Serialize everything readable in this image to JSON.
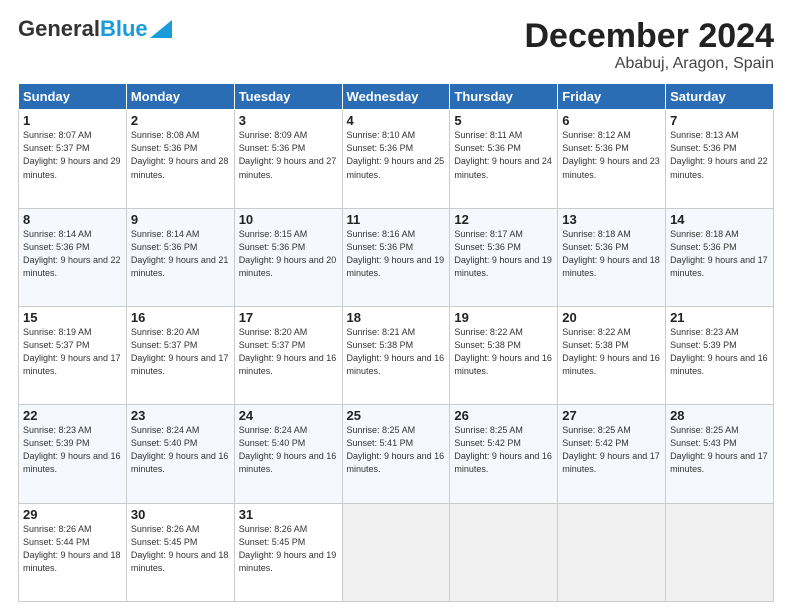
{
  "header": {
    "logo_general": "General",
    "logo_blue": "Blue",
    "month": "December 2024",
    "location": "Ababuj, Aragon, Spain"
  },
  "days_of_week": [
    "Sunday",
    "Monday",
    "Tuesday",
    "Wednesday",
    "Thursday",
    "Friday",
    "Saturday"
  ],
  "weeks": [
    [
      {
        "day": "1",
        "sunrise": "Sunrise: 8:07 AM",
        "sunset": "Sunset: 5:37 PM",
        "daylight": "Daylight: 9 hours and 29 minutes."
      },
      {
        "day": "2",
        "sunrise": "Sunrise: 8:08 AM",
        "sunset": "Sunset: 5:36 PM",
        "daylight": "Daylight: 9 hours and 28 minutes."
      },
      {
        "day": "3",
        "sunrise": "Sunrise: 8:09 AM",
        "sunset": "Sunset: 5:36 PM",
        "daylight": "Daylight: 9 hours and 27 minutes."
      },
      {
        "day": "4",
        "sunrise": "Sunrise: 8:10 AM",
        "sunset": "Sunset: 5:36 PM",
        "daylight": "Daylight: 9 hours and 25 minutes."
      },
      {
        "day": "5",
        "sunrise": "Sunrise: 8:11 AM",
        "sunset": "Sunset: 5:36 PM",
        "daylight": "Daylight: 9 hours and 24 minutes."
      },
      {
        "day": "6",
        "sunrise": "Sunrise: 8:12 AM",
        "sunset": "Sunset: 5:36 PM",
        "daylight": "Daylight: 9 hours and 23 minutes."
      },
      {
        "day": "7",
        "sunrise": "Sunrise: 8:13 AM",
        "sunset": "Sunset: 5:36 PM",
        "daylight": "Daylight: 9 hours and 22 minutes."
      }
    ],
    [
      {
        "day": "8",
        "sunrise": "Sunrise: 8:14 AM",
        "sunset": "Sunset: 5:36 PM",
        "daylight": "Daylight: 9 hours and 22 minutes."
      },
      {
        "day": "9",
        "sunrise": "Sunrise: 8:14 AM",
        "sunset": "Sunset: 5:36 PM",
        "daylight": "Daylight: 9 hours and 21 minutes."
      },
      {
        "day": "10",
        "sunrise": "Sunrise: 8:15 AM",
        "sunset": "Sunset: 5:36 PM",
        "daylight": "Daylight: 9 hours and 20 minutes."
      },
      {
        "day": "11",
        "sunrise": "Sunrise: 8:16 AM",
        "sunset": "Sunset: 5:36 PM",
        "daylight": "Daylight: 9 hours and 19 minutes."
      },
      {
        "day": "12",
        "sunrise": "Sunrise: 8:17 AM",
        "sunset": "Sunset: 5:36 PM",
        "daylight": "Daylight: 9 hours and 19 minutes."
      },
      {
        "day": "13",
        "sunrise": "Sunrise: 8:18 AM",
        "sunset": "Sunset: 5:36 PM",
        "daylight": "Daylight: 9 hours and 18 minutes."
      },
      {
        "day": "14",
        "sunrise": "Sunrise: 8:18 AM",
        "sunset": "Sunset: 5:36 PM",
        "daylight": "Daylight: 9 hours and 17 minutes."
      }
    ],
    [
      {
        "day": "15",
        "sunrise": "Sunrise: 8:19 AM",
        "sunset": "Sunset: 5:37 PM",
        "daylight": "Daylight: 9 hours and 17 minutes."
      },
      {
        "day": "16",
        "sunrise": "Sunrise: 8:20 AM",
        "sunset": "Sunset: 5:37 PM",
        "daylight": "Daylight: 9 hours and 17 minutes."
      },
      {
        "day": "17",
        "sunrise": "Sunrise: 8:20 AM",
        "sunset": "Sunset: 5:37 PM",
        "daylight": "Daylight: 9 hours and 16 minutes."
      },
      {
        "day": "18",
        "sunrise": "Sunrise: 8:21 AM",
        "sunset": "Sunset: 5:38 PM",
        "daylight": "Daylight: 9 hours and 16 minutes."
      },
      {
        "day": "19",
        "sunrise": "Sunrise: 8:22 AM",
        "sunset": "Sunset: 5:38 PM",
        "daylight": "Daylight: 9 hours and 16 minutes."
      },
      {
        "day": "20",
        "sunrise": "Sunrise: 8:22 AM",
        "sunset": "Sunset: 5:38 PM",
        "daylight": "Daylight: 9 hours and 16 minutes."
      },
      {
        "day": "21",
        "sunrise": "Sunrise: 8:23 AM",
        "sunset": "Sunset: 5:39 PM",
        "daylight": "Daylight: 9 hours and 16 minutes."
      }
    ],
    [
      {
        "day": "22",
        "sunrise": "Sunrise: 8:23 AM",
        "sunset": "Sunset: 5:39 PM",
        "daylight": "Daylight: 9 hours and 16 minutes."
      },
      {
        "day": "23",
        "sunrise": "Sunrise: 8:24 AM",
        "sunset": "Sunset: 5:40 PM",
        "daylight": "Daylight: 9 hours and 16 minutes."
      },
      {
        "day": "24",
        "sunrise": "Sunrise: 8:24 AM",
        "sunset": "Sunset: 5:40 PM",
        "daylight": "Daylight: 9 hours and 16 minutes."
      },
      {
        "day": "25",
        "sunrise": "Sunrise: 8:25 AM",
        "sunset": "Sunset: 5:41 PM",
        "daylight": "Daylight: 9 hours and 16 minutes."
      },
      {
        "day": "26",
        "sunrise": "Sunrise: 8:25 AM",
        "sunset": "Sunset: 5:42 PM",
        "daylight": "Daylight: 9 hours and 16 minutes."
      },
      {
        "day": "27",
        "sunrise": "Sunrise: 8:25 AM",
        "sunset": "Sunset: 5:42 PM",
        "daylight": "Daylight: 9 hours and 17 minutes."
      },
      {
        "day": "28",
        "sunrise": "Sunrise: 8:25 AM",
        "sunset": "Sunset: 5:43 PM",
        "daylight": "Daylight: 9 hours and 17 minutes."
      }
    ],
    [
      {
        "day": "29",
        "sunrise": "Sunrise: 8:26 AM",
        "sunset": "Sunset: 5:44 PM",
        "daylight": "Daylight: 9 hours and 18 minutes."
      },
      {
        "day": "30",
        "sunrise": "Sunrise: 8:26 AM",
        "sunset": "Sunset: 5:45 PM",
        "daylight": "Daylight: 9 hours and 18 minutes."
      },
      {
        "day": "31",
        "sunrise": "Sunrise: 8:26 AM",
        "sunset": "Sunset: 5:45 PM",
        "daylight": "Daylight: 9 hours and 19 minutes."
      },
      null,
      null,
      null,
      null
    ]
  ]
}
